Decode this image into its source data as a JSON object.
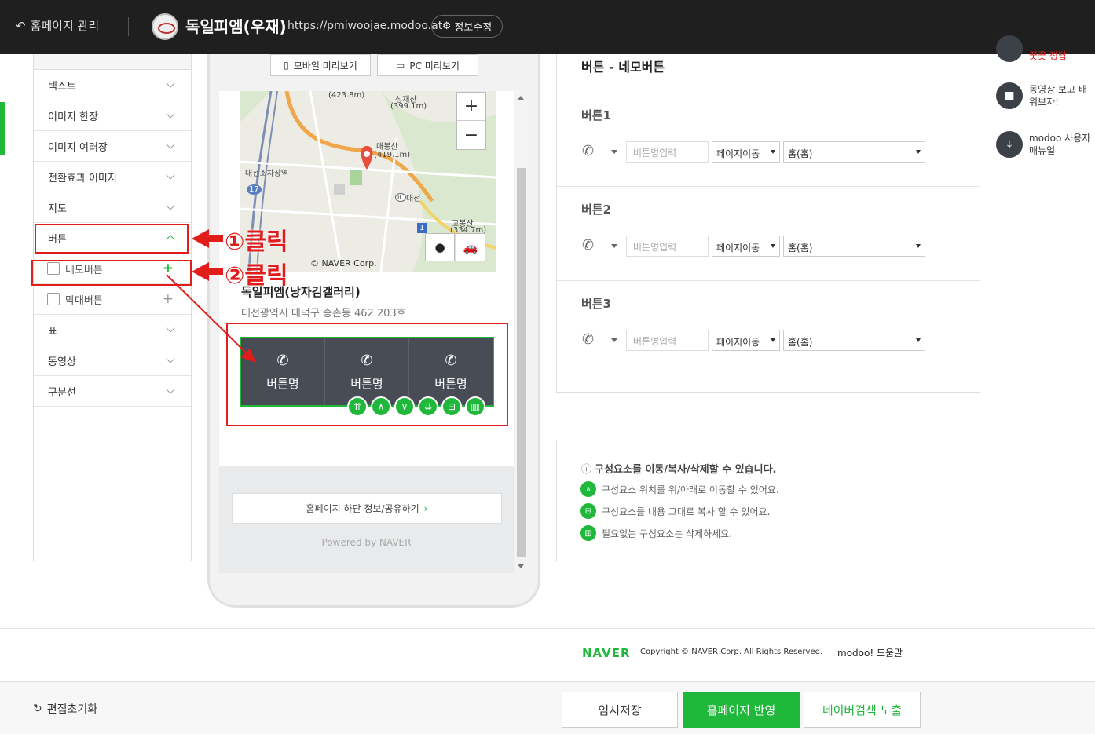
{
  "topbar": {
    "back_label": "홈페이지 관리",
    "site_name": "독일피엠(우재)",
    "url": "https://pmiwoojae.modoo.at",
    "edit_label": "정보수정"
  },
  "sidebar": {
    "items": [
      {
        "label": "텍스트"
      },
      {
        "label": "이미지 한장"
      },
      {
        "label": "이미지 여러장"
      },
      {
        "label": "전환효과 이미지"
      },
      {
        "label": "지도"
      },
      {
        "label": "버튼"
      }
    ],
    "sub_items": [
      {
        "label": "네모버튼"
      },
      {
        "label": "막대버튼"
      }
    ],
    "items_after": [
      {
        "label": "표"
      },
      {
        "label": "동영상"
      },
      {
        "label": "구분선"
      }
    ]
  },
  "annotations": {
    "click1": "①클릭",
    "click2": "②클릭"
  },
  "preview": {
    "mobile_label": "모바일 미리보기",
    "pc_label": "PC 미리보기",
    "map_labels": [
      "(423.8m)",
      "성재산",
      "(399.1m)",
      "매봉산",
      "(419.1m)",
      "대전조차장역",
      "대전",
      "고봉산",
      "(334.7m)",
      "17",
      "1",
      "IC"
    ],
    "map_copyright": "© NAVER Corp.",
    "business_name": "독일피엠(낭자김갤러리)",
    "business_address": "대전광역시 대덕구 송촌동 462   203호",
    "buttons": [
      {
        "label": "버튼명"
      },
      {
        "label": "버튼명"
      },
      {
        "label": "버튼명"
      }
    ],
    "share_link": "홈페이지 하단 정보/공유하기",
    "powered_by": "Powered by NAVER"
  },
  "panel": {
    "title": "버튼 - 네모버튼",
    "groups": [
      {
        "label": "버튼1",
        "name_placeholder": "버튼명입력",
        "action": "페이지이동",
        "target": "홈(홈)"
      },
      {
        "label": "버튼2",
        "name_placeholder": "버튼명입력",
        "action": "페이지이동",
        "target": "홈(홈)"
      },
      {
        "label": "버튼3",
        "name_placeholder": "버튼명입력",
        "action": "페이지이동",
        "target": "홈(홈)"
      }
    ]
  },
  "info": {
    "title": "구성요소를 이동/복사/삭제할 수 있습니다.",
    "lines": [
      "구성요소 위치를 위/아래로 이동할 수 있어요.",
      "구성요소를 내용 그대로 복사 할 수 있어요.",
      "필요없는 구성요소는 삭제하세요."
    ]
  },
  "help": {
    "partial_label": "꿋꿋 정답",
    "video_label": "동영상 보고 배워보자!",
    "manual_label": "modoo 사용자 매뉴얼"
  },
  "footer": {
    "naver": "NAVER",
    "copyright": "Copyright © NAVER Corp. All Rights Reserved.",
    "modoo_help": "modoo! 도움말"
  },
  "bottom": {
    "reset_label": "편집초기화",
    "save_label": "임시저장",
    "publish_label": "홈페이지 반영",
    "search_label": "네이버검색 노출"
  },
  "colors": {
    "accent": "#1fb83b",
    "topbar": "#1f1f1f",
    "annotation_red": "#e21b1b",
    "button_block": "#474c55"
  }
}
